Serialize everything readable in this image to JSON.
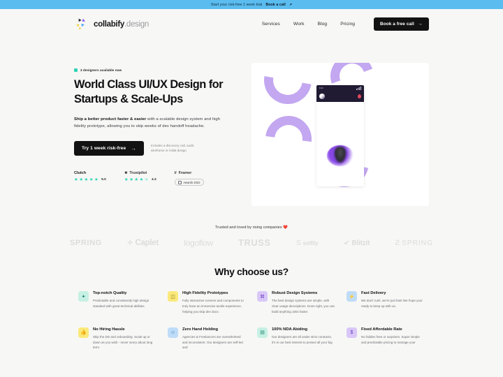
{
  "announcement": {
    "text": "Start your risk-free 1 week trial",
    "cta": "Book a call",
    "arrow": "↗",
    "bg": "#5bbcf0"
  },
  "header": {
    "brand_name": "collabify",
    "brand_suffix": ".design",
    "nav": [
      {
        "label": "Services"
      },
      {
        "label": "Work"
      },
      {
        "label": "Blog"
      },
      {
        "label": "Pricing"
      }
    ],
    "cta_label": "Book a free call",
    "cta_arrow": "→"
  },
  "hero": {
    "badge": "3 designers available now",
    "badge_color": "#2fd3b5",
    "title": "World Class UI/UX Design for Startups & Scale-Ups",
    "sub_bold": "Ship a better product faster & easier",
    "sub_rest": " with a scalable design system and high fidelity prototype, allowing you to skip weeks of dev handoff headache.",
    "cta_label": "Try 1 week risk-free",
    "cta_arrow": "→",
    "cta_note": "Includes a discovery call, audit, wireframe or initial design"
  },
  "ratings": [
    {
      "name": "Clutch",
      "score": "5.0",
      "stars": 5,
      "half": 0,
      "icon": ""
    },
    {
      "name": "Trustpilot",
      "score": "4.3",
      "stars": 4,
      "half": 1,
      "icon": "★"
    },
    {
      "name": "Framer",
      "award": "Awards 2022",
      "icon": "F"
    }
  ],
  "trusted": {
    "text": "Trusted and loved by rising companies ❤️",
    "logos": [
      {
        "name": "SPRING"
      },
      {
        "name": "Caplet",
        "glyph": "✛"
      },
      {
        "name": "logoflow"
      },
      {
        "name": "TRUSS"
      },
      {
        "name": "selfily",
        "glyph": "S"
      },
      {
        "name": "Blitzit",
        "glyph": "✔"
      },
      {
        "name": "SPRING",
        "glyph": "Ꙅ"
      }
    ]
  },
  "why": {
    "title": "Why choose us?",
    "features": [
      {
        "title": "Top-notch Quality",
        "body": "Predictable and consistently high design standard with great technical abilities.",
        "icon": "✦",
        "bg": "#c6f0e4",
        "fg": "#1d7f6b"
      },
      {
        "title": "High Fidelity Prototypes",
        "body": "Fully interactive screens and components to truly have an immersive tactile experience, helping you skip dev docs.",
        "icon": "C",
        "bg": "#fae97a",
        "fg": "#8a7610"
      },
      {
        "title": "Robust Design Systems",
        "body": "The best design systems are simple, with clear usage descriptions. Done right, you can build anything 100x faster.",
        "icon": "⌘",
        "bg": "#d9c7f7",
        "fg": "#6b3fbf"
      },
      {
        "title": "Fast Delivery",
        "body": "We don't rush, we're just fast! We hope your ready to keep up with us.",
        "icon": "⚡",
        "bg": "#bedcf8",
        "fg": "#2f6fb0"
      },
      {
        "title": "No Hiring Hassle",
        "body": "Skip the DD and onboarding. Scale up or down as you wish - never worry about long term",
        "icon": "👍",
        "bg": "#fae97a",
        "fg": "#8a7610"
      },
      {
        "title": "Zero Hand Holding",
        "body": "Agencies & Freelancers are overwhelmed and inconsistent. Our designers are self-led and",
        "icon": "☺",
        "bg": "#bedcf8",
        "fg": "#2f6fb0"
      },
      {
        "title": "100% NDA Abiding",
        "body": "Our designers are all under strict contracts, it's in our best interest to protect all your big",
        "icon": "▤",
        "bg": "#c6f0e4",
        "fg": "#1d7f6b"
      },
      {
        "title": "Fixed Affordable Rate",
        "body": "No hidden fees or surprises. Super simple and predictable pricing to manage your",
        "icon": "$",
        "bg": "#d9c7f7",
        "fg": "#6b3fbf"
      }
    ]
  }
}
